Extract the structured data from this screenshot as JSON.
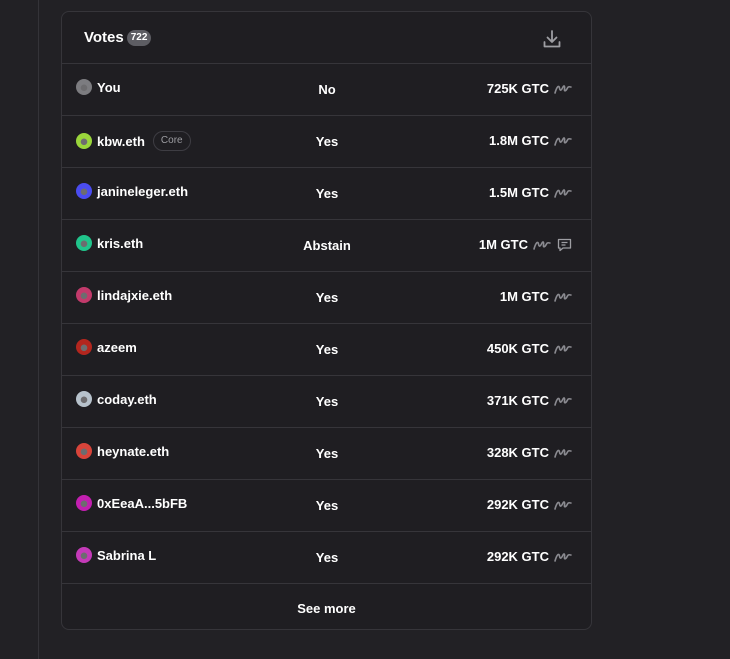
{
  "header": {
    "title": "Votes",
    "count": "722"
  },
  "votes": [
    {
      "name": "You",
      "choice": "No",
      "power": "725K GTC",
      "avatar_color": "#7c7c80",
      "core": false,
      "comment": false
    },
    {
      "name": "kbw.eth",
      "choice": "Yes",
      "power": "1.8M GTC",
      "avatar_color": "#9ad63b",
      "core": true,
      "core_label": "Core",
      "comment": false
    },
    {
      "name": "janineleger.eth",
      "choice": "Yes",
      "power": "1.5M GTC",
      "avatar_color": "#4a4cf0",
      "core": false,
      "comment": false
    },
    {
      "name": "kris.eth",
      "choice": "Abstain",
      "power": "1M GTC",
      "avatar_color": "#20c48b",
      "core": false,
      "comment": true
    },
    {
      "name": "lindajxie.eth",
      "choice": "Yes",
      "power": "1M GTC",
      "avatar_color": "#c23a6b",
      "core": false,
      "comment": false
    },
    {
      "name": "azeem",
      "choice": "Yes",
      "power": "450K GTC",
      "avatar_color": "#b3261e",
      "core": false,
      "comment": false
    },
    {
      "name": "coday.eth",
      "choice": "Yes",
      "power": "371K GTC",
      "avatar_color": "#b7c2cc",
      "core": false,
      "comment": false
    },
    {
      "name": "heynate.eth",
      "choice": "Yes",
      "power": "328K GTC",
      "avatar_color": "#d8443a",
      "core": false,
      "comment": false
    },
    {
      "name": "0xEeaA...5bFB",
      "choice": "Yes",
      "power": "292K GTC",
      "avatar_color": "#c21fb0",
      "core": false,
      "comment": false
    },
    {
      "name": "Sabrina L",
      "choice": "Yes",
      "power": "292K GTC",
      "avatar_color": "#c43ab8",
      "core": false,
      "comment": false
    }
  ],
  "footer": {
    "see_more": "See more"
  },
  "icons": {
    "download": "download-icon",
    "signature": "signature-icon",
    "comment": "comment-icon"
  }
}
